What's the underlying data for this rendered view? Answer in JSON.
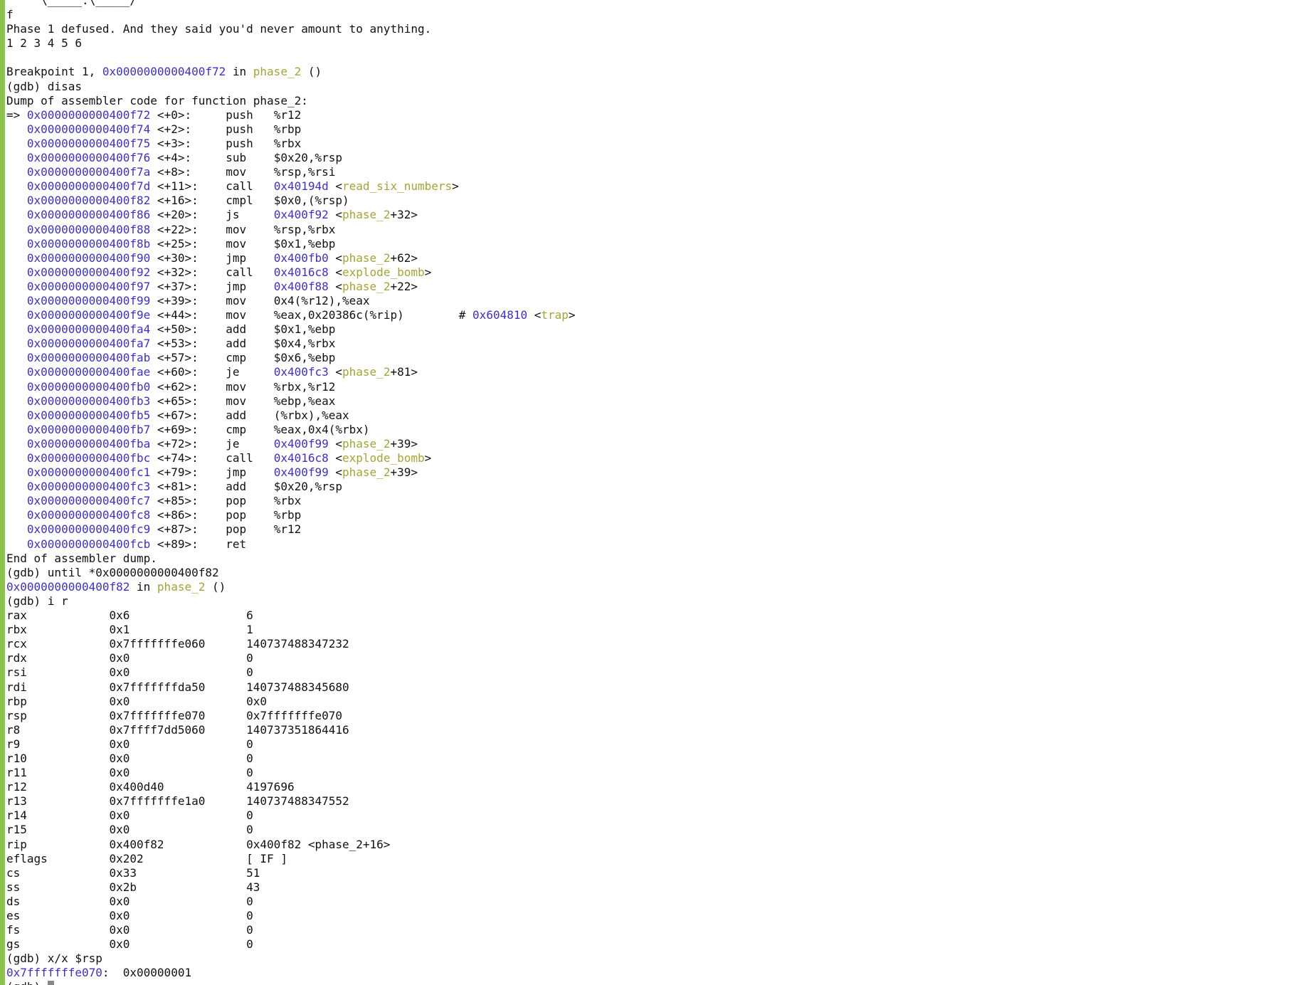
{
  "colors": {
    "gutter": "#8bc34a",
    "address": "#3b30cf",
    "symbol": "#a3a534",
    "text": "#111111",
    "cursor": "#888888"
  },
  "lines": [
    [
      {
        "t": "     \\_____.\\_____/"
      }
    ],
    [
      {
        "t": "f"
      }
    ],
    [
      {
        "t": "Phase 1 defused. And they said you'd never amount to anything."
      }
    ],
    [
      {
        "t": "1 2 3 4 5 6"
      }
    ],
    [
      {
        "t": ""
      }
    ],
    [
      {
        "t": "Breakpoint 1, "
      },
      {
        "t": "0x0000000000400f72",
        "c": "addr"
      },
      {
        "t": " in "
      },
      {
        "t": "phase_2",
        "c": "sym"
      },
      {
        "t": " ()"
      }
    ],
    [
      {
        "t": "(gdb) disas"
      }
    ],
    [
      {
        "t": "Dump of assembler code for function phase_2:"
      }
    ],
    [
      {
        "t": "=> "
      },
      {
        "t": "0x0000000000400f72",
        "c": "addr"
      },
      {
        "t": " <+0>:     push   %r12"
      }
    ],
    [
      {
        "t": "   "
      },
      {
        "t": "0x0000000000400f74",
        "c": "addr"
      },
      {
        "t": " <+2>:     push   %rbp"
      }
    ],
    [
      {
        "t": "   "
      },
      {
        "t": "0x0000000000400f75",
        "c": "addr"
      },
      {
        "t": " <+3>:     push   %rbx"
      }
    ],
    [
      {
        "t": "   "
      },
      {
        "t": "0x0000000000400f76",
        "c": "addr"
      },
      {
        "t": " <+4>:     sub    $0x20,%rsp"
      }
    ],
    [
      {
        "t": "   "
      },
      {
        "t": "0x0000000000400f7a",
        "c": "addr"
      },
      {
        "t": " <+8>:     mov    %rsp,%rsi"
      }
    ],
    [
      {
        "t": "   "
      },
      {
        "t": "0x0000000000400f7d",
        "c": "addr"
      },
      {
        "t": " <+11>:    call   "
      },
      {
        "t": "0x40194d",
        "c": "addr"
      },
      {
        "t": " <"
      },
      {
        "t": "read_six_numbers",
        "c": "sym"
      },
      {
        "t": ">"
      }
    ],
    [
      {
        "t": "   "
      },
      {
        "t": "0x0000000000400f82",
        "c": "addr"
      },
      {
        "t": " <+16>:    cmpl   $0x0,(%rsp)"
      }
    ],
    [
      {
        "t": "   "
      },
      {
        "t": "0x0000000000400f86",
        "c": "addr"
      },
      {
        "t": " <+20>:    js     "
      },
      {
        "t": "0x400f92",
        "c": "addr"
      },
      {
        "t": " <"
      },
      {
        "t": "phase_2",
        "c": "sym"
      },
      {
        "t": "+32>"
      }
    ],
    [
      {
        "t": "   "
      },
      {
        "t": "0x0000000000400f88",
        "c": "addr"
      },
      {
        "t": " <+22>:    mov    %rsp,%rbx"
      }
    ],
    [
      {
        "t": "   "
      },
      {
        "t": "0x0000000000400f8b",
        "c": "addr"
      },
      {
        "t": " <+25>:    mov    $0x1,%ebp"
      }
    ],
    [
      {
        "t": "   "
      },
      {
        "t": "0x0000000000400f90",
        "c": "addr"
      },
      {
        "t": " <+30>:    jmp    "
      },
      {
        "t": "0x400fb0",
        "c": "addr"
      },
      {
        "t": " <"
      },
      {
        "t": "phase_2",
        "c": "sym"
      },
      {
        "t": "+62>"
      }
    ],
    [
      {
        "t": "   "
      },
      {
        "t": "0x0000000000400f92",
        "c": "addr"
      },
      {
        "t": " <+32>:    call   "
      },
      {
        "t": "0x4016c8",
        "c": "addr"
      },
      {
        "t": " <"
      },
      {
        "t": "explode_bomb",
        "c": "sym"
      },
      {
        "t": ">"
      }
    ],
    [
      {
        "t": "   "
      },
      {
        "t": "0x0000000000400f97",
        "c": "addr"
      },
      {
        "t": " <+37>:    jmp    "
      },
      {
        "t": "0x400f88",
        "c": "addr"
      },
      {
        "t": " <"
      },
      {
        "t": "phase_2",
        "c": "sym"
      },
      {
        "t": "+22>"
      }
    ],
    [
      {
        "t": "   "
      },
      {
        "t": "0x0000000000400f99",
        "c": "addr"
      },
      {
        "t": " <+39>:    mov    0x4(%r12),%eax"
      }
    ],
    [
      {
        "t": "   "
      },
      {
        "t": "0x0000000000400f9e",
        "c": "addr"
      },
      {
        "t": " <+44>:    mov    %eax,0x20386c(%rip)        # "
      },
      {
        "t": "0x604810",
        "c": "addr"
      },
      {
        "t": " <"
      },
      {
        "t": "trap",
        "c": "sym"
      },
      {
        "t": ">"
      }
    ],
    [
      {
        "t": "   "
      },
      {
        "t": "0x0000000000400fa4",
        "c": "addr"
      },
      {
        "t": " <+50>:    add    $0x1,%ebp"
      }
    ],
    [
      {
        "t": "   "
      },
      {
        "t": "0x0000000000400fa7",
        "c": "addr"
      },
      {
        "t": " <+53>:    add    $0x4,%rbx"
      }
    ],
    [
      {
        "t": "   "
      },
      {
        "t": "0x0000000000400fab",
        "c": "addr"
      },
      {
        "t": " <+57>:    cmp    $0x6,%ebp"
      }
    ],
    [
      {
        "t": "   "
      },
      {
        "t": "0x0000000000400fae",
        "c": "addr"
      },
      {
        "t": " <+60>:    je     "
      },
      {
        "t": "0x400fc3",
        "c": "addr"
      },
      {
        "t": " <"
      },
      {
        "t": "phase_2",
        "c": "sym"
      },
      {
        "t": "+81>"
      }
    ],
    [
      {
        "t": "   "
      },
      {
        "t": "0x0000000000400fb0",
        "c": "addr"
      },
      {
        "t": " <+62>:    mov    %rbx,%r12"
      }
    ],
    [
      {
        "t": "   "
      },
      {
        "t": "0x0000000000400fb3",
        "c": "addr"
      },
      {
        "t": " <+65>:    mov    %ebp,%eax"
      }
    ],
    [
      {
        "t": "   "
      },
      {
        "t": "0x0000000000400fb5",
        "c": "addr"
      },
      {
        "t": " <+67>:    add    (%rbx),%eax"
      }
    ],
    [
      {
        "t": "   "
      },
      {
        "t": "0x0000000000400fb7",
        "c": "addr"
      },
      {
        "t": " <+69>:    cmp    %eax,0x4(%rbx)"
      }
    ],
    [
      {
        "t": "   "
      },
      {
        "t": "0x0000000000400fba",
        "c": "addr"
      },
      {
        "t": " <+72>:    je     "
      },
      {
        "t": "0x400f99",
        "c": "addr"
      },
      {
        "t": " <"
      },
      {
        "t": "phase_2",
        "c": "sym"
      },
      {
        "t": "+39>"
      }
    ],
    [
      {
        "t": "   "
      },
      {
        "t": "0x0000000000400fbc",
        "c": "addr"
      },
      {
        "t": " <+74>:    call   "
      },
      {
        "t": "0x4016c8",
        "c": "addr"
      },
      {
        "t": " <"
      },
      {
        "t": "explode_bomb",
        "c": "sym"
      },
      {
        "t": ">"
      }
    ],
    [
      {
        "t": "   "
      },
      {
        "t": "0x0000000000400fc1",
        "c": "addr"
      },
      {
        "t": " <+79>:    jmp    "
      },
      {
        "t": "0x400f99",
        "c": "addr"
      },
      {
        "t": " <"
      },
      {
        "t": "phase_2",
        "c": "sym"
      },
      {
        "t": "+39>"
      }
    ],
    [
      {
        "t": "   "
      },
      {
        "t": "0x0000000000400fc3",
        "c": "addr"
      },
      {
        "t": " <+81>:    add    $0x20,%rsp"
      }
    ],
    [
      {
        "t": "   "
      },
      {
        "t": "0x0000000000400fc7",
        "c": "addr"
      },
      {
        "t": " <+85>:    pop    %rbx"
      }
    ],
    [
      {
        "t": "   "
      },
      {
        "t": "0x0000000000400fc8",
        "c": "addr"
      },
      {
        "t": " <+86>:    pop    %rbp"
      }
    ],
    [
      {
        "t": "   "
      },
      {
        "t": "0x0000000000400fc9",
        "c": "addr"
      },
      {
        "t": " <+87>:    pop    %r12"
      }
    ],
    [
      {
        "t": "   "
      },
      {
        "t": "0x0000000000400fcb",
        "c": "addr"
      },
      {
        "t": " <+89>:    ret"
      }
    ],
    [
      {
        "t": "End of assembler dump."
      }
    ],
    [
      {
        "t": "(gdb) until *0x0000000000400f82"
      }
    ],
    [
      {
        "t": "0x0000000000400f82",
        "c": "addr"
      },
      {
        "t": " in "
      },
      {
        "t": "phase_2",
        "c": "sym"
      },
      {
        "t": " ()"
      }
    ],
    [
      {
        "t": "(gdb) i r"
      }
    ],
    [
      {
        "t": "rax            0x6                 6"
      }
    ],
    [
      {
        "t": "rbx            0x1                 1"
      }
    ],
    [
      {
        "t": "rcx            0x7fffffffe060      140737488347232"
      }
    ],
    [
      {
        "t": "rdx            0x0                 0"
      }
    ],
    [
      {
        "t": "rsi            0x0                 0"
      }
    ],
    [
      {
        "t": "rdi            0x7fffffffda50      140737488345680"
      }
    ],
    [
      {
        "t": "rbp            0x0                 0x0"
      }
    ],
    [
      {
        "t": "rsp            0x7fffffffe070      0x7fffffffe070"
      }
    ],
    [
      {
        "t": "r8             0x7ffff7dd5060      140737351864416"
      }
    ],
    [
      {
        "t": "r9             0x0                 0"
      }
    ],
    [
      {
        "t": "r10            0x0                 0"
      }
    ],
    [
      {
        "t": "r11            0x0                 0"
      }
    ],
    [
      {
        "t": "r12            0x400d40            4197696"
      }
    ],
    [
      {
        "t": "r13            0x7fffffffe1a0      140737488347552"
      }
    ],
    [
      {
        "t": "r14            0x0                 0"
      }
    ],
    [
      {
        "t": "r15            0x0                 0"
      }
    ],
    [
      {
        "t": "rip            0x400f82            0x400f82 <phase_2+16>"
      }
    ],
    [
      {
        "t": "eflags         0x202               [ IF ]"
      }
    ],
    [
      {
        "t": "cs             0x33                51"
      }
    ],
    [
      {
        "t": "ss             0x2b                43"
      }
    ],
    [
      {
        "t": "ds             0x0                 0"
      }
    ],
    [
      {
        "t": "es             0x0                 0"
      }
    ],
    [
      {
        "t": "fs             0x0                 0"
      }
    ],
    [
      {
        "t": "gs             0x0                 0"
      }
    ],
    [
      {
        "t": "(gdb) x/x $rsp"
      }
    ],
    [
      {
        "t": "0x7fffffffe070",
        "c": "addr"
      },
      {
        "t": ":  0x00000001"
      }
    ],
    [
      {
        "t": "(gdb) "
      }
    ]
  ]
}
